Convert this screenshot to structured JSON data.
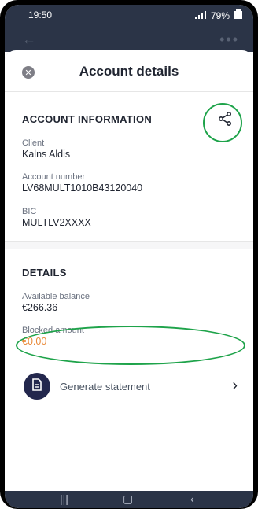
{
  "status_bar": {
    "time": "19:50",
    "signal_text": "Vo) LTE1 .ıl",
    "battery": "79%"
  },
  "header": {
    "back_icon": "arrow-left-icon",
    "more_icon": "more-horizontal-icon"
  },
  "sheet": {
    "title": "Account details",
    "close_icon": "close-icon",
    "account_info": {
      "heading": "ACCOUNT INFORMATION",
      "share_icon": "share-icon",
      "client_label": "Client",
      "client_value": "Kalns Aldis",
      "account_number_label": "Account number",
      "account_number_value": "LV68MULT1010B43120040",
      "bic_label": "BIC",
      "bic_value": "MULTLV2XXXX"
    },
    "details": {
      "heading": "DETAILS",
      "available_balance_label": "Available balance",
      "available_balance_value": "€266.36",
      "blocked_amount_label": "Blocked amount",
      "blocked_amount_value": "€0.00"
    },
    "generate_statement": {
      "label": "Generate statement",
      "icon": "document-icon",
      "chevron": "chevron-right-icon"
    }
  },
  "navbar": {
    "recent_icon": "recent-apps-icon",
    "home_icon": "home-icon",
    "back_icon": "back-icon"
  },
  "colors": {
    "header_bg": "#2b3447",
    "accent_green": "#1ea34a",
    "doc_button_bg": "#23274d",
    "blocked_amount": "#e98a3a"
  }
}
